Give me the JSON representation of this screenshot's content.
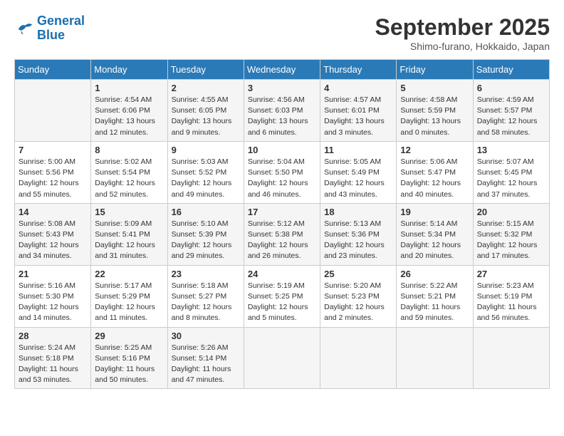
{
  "logo": {
    "line1": "General",
    "line2": "Blue"
  },
  "title": "September 2025",
  "subtitle": "Shimo-furano, Hokkaido, Japan",
  "days_of_week": [
    "Sunday",
    "Monday",
    "Tuesday",
    "Wednesday",
    "Thursday",
    "Friday",
    "Saturday"
  ],
  "weeks": [
    [
      {
        "day": "",
        "info": ""
      },
      {
        "day": "1",
        "info": "Sunrise: 4:54 AM\nSunset: 6:06 PM\nDaylight: 13 hours\nand 12 minutes."
      },
      {
        "day": "2",
        "info": "Sunrise: 4:55 AM\nSunset: 6:05 PM\nDaylight: 13 hours\nand 9 minutes."
      },
      {
        "day": "3",
        "info": "Sunrise: 4:56 AM\nSunset: 6:03 PM\nDaylight: 13 hours\nand 6 minutes."
      },
      {
        "day": "4",
        "info": "Sunrise: 4:57 AM\nSunset: 6:01 PM\nDaylight: 13 hours\nand 3 minutes."
      },
      {
        "day": "5",
        "info": "Sunrise: 4:58 AM\nSunset: 5:59 PM\nDaylight: 13 hours\nand 0 minutes."
      },
      {
        "day": "6",
        "info": "Sunrise: 4:59 AM\nSunset: 5:57 PM\nDaylight: 12 hours\nand 58 minutes."
      }
    ],
    [
      {
        "day": "7",
        "info": "Sunrise: 5:00 AM\nSunset: 5:56 PM\nDaylight: 12 hours\nand 55 minutes."
      },
      {
        "day": "8",
        "info": "Sunrise: 5:02 AM\nSunset: 5:54 PM\nDaylight: 12 hours\nand 52 minutes."
      },
      {
        "day": "9",
        "info": "Sunrise: 5:03 AM\nSunset: 5:52 PM\nDaylight: 12 hours\nand 49 minutes."
      },
      {
        "day": "10",
        "info": "Sunrise: 5:04 AM\nSunset: 5:50 PM\nDaylight: 12 hours\nand 46 minutes."
      },
      {
        "day": "11",
        "info": "Sunrise: 5:05 AM\nSunset: 5:49 PM\nDaylight: 12 hours\nand 43 minutes."
      },
      {
        "day": "12",
        "info": "Sunrise: 5:06 AM\nSunset: 5:47 PM\nDaylight: 12 hours\nand 40 minutes."
      },
      {
        "day": "13",
        "info": "Sunrise: 5:07 AM\nSunset: 5:45 PM\nDaylight: 12 hours\nand 37 minutes."
      }
    ],
    [
      {
        "day": "14",
        "info": "Sunrise: 5:08 AM\nSunset: 5:43 PM\nDaylight: 12 hours\nand 34 minutes."
      },
      {
        "day": "15",
        "info": "Sunrise: 5:09 AM\nSunset: 5:41 PM\nDaylight: 12 hours\nand 31 minutes."
      },
      {
        "day": "16",
        "info": "Sunrise: 5:10 AM\nSunset: 5:39 PM\nDaylight: 12 hours\nand 29 minutes."
      },
      {
        "day": "17",
        "info": "Sunrise: 5:12 AM\nSunset: 5:38 PM\nDaylight: 12 hours\nand 26 minutes."
      },
      {
        "day": "18",
        "info": "Sunrise: 5:13 AM\nSunset: 5:36 PM\nDaylight: 12 hours\nand 23 minutes."
      },
      {
        "day": "19",
        "info": "Sunrise: 5:14 AM\nSunset: 5:34 PM\nDaylight: 12 hours\nand 20 minutes."
      },
      {
        "day": "20",
        "info": "Sunrise: 5:15 AM\nSunset: 5:32 PM\nDaylight: 12 hours\nand 17 minutes."
      }
    ],
    [
      {
        "day": "21",
        "info": "Sunrise: 5:16 AM\nSunset: 5:30 PM\nDaylight: 12 hours\nand 14 minutes."
      },
      {
        "day": "22",
        "info": "Sunrise: 5:17 AM\nSunset: 5:29 PM\nDaylight: 12 hours\nand 11 minutes."
      },
      {
        "day": "23",
        "info": "Sunrise: 5:18 AM\nSunset: 5:27 PM\nDaylight: 12 hours\nand 8 minutes."
      },
      {
        "day": "24",
        "info": "Sunrise: 5:19 AM\nSunset: 5:25 PM\nDaylight: 12 hours\nand 5 minutes."
      },
      {
        "day": "25",
        "info": "Sunrise: 5:20 AM\nSunset: 5:23 PM\nDaylight: 12 hours\nand 2 minutes."
      },
      {
        "day": "26",
        "info": "Sunrise: 5:22 AM\nSunset: 5:21 PM\nDaylight: 11 hours\nand 59 minutes."
      },
      {
        "day": "27",
        "info": "Sunrise: 5:23 AM\nSunset: 5:19 PM\nDaylight: 11 hours\nand 56 minutes."
      }
    ],
    [
      {
        "day": "28",
        "info": "Sunrise: 5:24 AM\nSunset: 5:18 PM\nDaylight: 11 hours\nand 53 minutes."
      },
      {
        "day": "29",
        "info": "Sunrise: 5:25 AM\nSunset: 5:16 PM\nDaylight: 11 hours\nand 50 minutes."
      },
      {
        "day": "30",
        "info": "Sunrise: 5:26 AM\nSunset: 5:14 PM\nDaylight: 11 hours\nand 47 minutes."
      },
      {
        "day": "",
        "info": ""
      },
      {
        "day": "",
        "info": ""
      },
      {
        "day": "",
        "info": ""
      },
      {
        "day": "",
        "info": ""
      }
    ]
  ]
}
